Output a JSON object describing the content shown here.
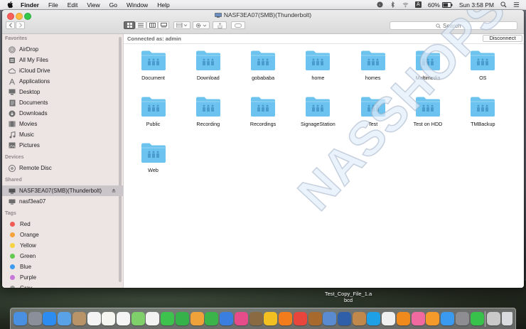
{
  "menubar": {
    "app_name": "Finder",
    "items": [
      "File",
      "Edit",
      "View",
      "Go",
      "Window",
      "Help"
    ],
    "battery": "60%",
    "clock": "Sun 3:58 PM",
    "input_letter": "A"
  },
  "window": {
    "title": "NASF3EA07(SMB)(Thunderbolt)",
    "search_placeholder": "Search"
  },
  "sidebar": {
    "favorites_header": "Favorites",
    "favorites": [
      {
        "label": "AirDrop",
        "icon": "airdrop-icon"
      },
      {
        "label": "All My Files",
        "icon": "all-files-icon"
      },
      {
        "label": "iCloud Drive",
        "icon": "cloud-icon"
      },
      {
        "label": "Applications",
        "icon": "applications-icon"
      },
      {
        "label": "Desktop",
        "icon": "desktop-icon"
      },
      {
        "label": "Documents",
        "icon": "documents-icon"
      },
      {
        "label": "Downloads",
        "icon": "downloads-icon"
      },
      {
        "label": "Movies",
        "icon": "movies-icon"
      },
      {
        "label": "Music",
        "icon": "music-icon"
      },
      {
        "label": "Pictures",
        "icon": "pictures-icon"
      }
    ],
    "devices_header": "Devices",
    "devices": [
      {
        "label": "Remote Disc",
        "icon": "disc-icon"
      }
    ],
    "shared_header": "Shared",
    "shared": [
      {
        "label": "NASF3EA07(SMB)(Thunderbolt)",
        "icon": "server-icon",
        "selected": true
      },
      {
        "label": "nasf3ea07",
        "icon": "server-icon",
        "selected": false
      }
    ],
    "tags_header": "Tags",
    "tags": [
      {
        "label": "Red",
        "color": "#f05b55"
      },
      {
        "label": "Orange",
        "color": "#f6a23b"
      },
      {
        "label": "Yellow",
        "color": "#f7d43e"
      },
      {
        "label": "Green",
        "color": "#63c950"
      },
      {
        "label": "Blue",
        "color": "#3d9bf0"
      },
      {
        "label": "Purple",
        "color": "#c878d8"
      },
      {
        "label": "Gray",
        "color": "#9a9a9a"
      }
    ]
  },
  "content": {
    "connected_as": "Connected as: admin",
    "disconnect_label": "Disconnect",
    "folders": [
      "Document",
      "Download",
      "gobababa",
      "home",
      "homes",
      "Multimedia",
      "OS",
      "Public",
      "Recording",
      "Recordings",
      "SignageStation",
      "Test",
      "Test on HDD",
      "TMBackup",
      "Web"
    ],
    "folder_color": "#6cc3ee",
    "watermark": "NASSHOPS.net"
  },
  "desktop": {
    "file_name_line1": "Test_Copy_File_1.a",
    "file_name_line2": "bcd"
  },
  "dock": {
    "apps": [
      {
        "name": "finder-icon",
        "color": "#4a90e2"
      },
      {
        "name": "launchpad-icon",
        "color": "#8a8f99"
      },
      {
        "name": "safari-icon",
        "color": "#2d8cf0"
      },
      {
        "name": "mail-icon",
        "color": "#5aa2e8"
      },
      {
        "name": "contacts-icon",
        "color": "#b89468"
      },
      {
        "name": "calendar-icon",
        "color": "#f4f4f4"
      },
      {
        "name": "notes-icon",
        "color": "#f6f6f0"
      },
      {
        "name": "reminders-icon",
        "color": "#f5f5f5"
      },
      {
        "name": "maps-icon",
        "color": "#7fcf6a"
      },
      {
        "name": "photos-icon",
        "color": "#f2f2f2"
      },
      {
        "name": "messages-icon",
        "color": "#3ec24e"
      },
      {
        "name": "facetime-icon",
        "color": "#36b24a"
      },
      {
        "name": "pages-icon",
        "color": "#f0a23a"
      },
      {
        "name": "numbers-icon",
        "color": "#3bb54a"
      },
      {
        "name": "keynote-icon",
        "color": "#3a7fe0"
      },
      {
        "name": "itunes-icon",
        "color": "#e64b8a"
      },
      {
        "name": "vlc-icon",
        "color": "#8a6a40"
      },
      {
        "name": "radiation-icon",
        "color": "#f2c020"
      },
      {
        "name": "firefox-icon",
        "color": "#f27b1c"
      },
      {
        "name": "chrome-icon",
        "color": "#e8453c"
      },
      {
        "name": "game-icon",
        "color": "#a86a2c"
      },
      {
        "name": "compass-icon",
        "color": "#5a8ad0"
      },
      {
        "name": "quicktime-icon",
        "color": "#2f5fa8"
      },
      {
        "name": "archive-icon",
        "color": "#c0884a"
      },
      {
        "name": "skype-icon",
        "color": "#1ea0e6"
      },
      {
        "name": "bluetooth-icon",
        "color": "#f0f0f0"
      },
      {
        "name": "vlc-cone-icon",
        "color": "#f18a1c"
      },
      {
        "name": "music-app-icon",
        "color": "#f06aa0"
      },
      {
        "name": "ibooks-icon",
        "color": "#f39a2a"
      },
      {
        "name": "app-store-icon",
        "color": "#3a9af0"
      },
      {
        "name": "system-preferences-icon",
        "color": "#8d8d92"
      },
      {
        "name": "line-icon",
        "color": "#38c24b"
      },
      {
        "name": "downloads-stack-icon",
        "color": "#c9c9c9"
      },
      {
        "name": "trash-icon",
        "color": "#d9dbdf"
      }
    ]
  }
}
